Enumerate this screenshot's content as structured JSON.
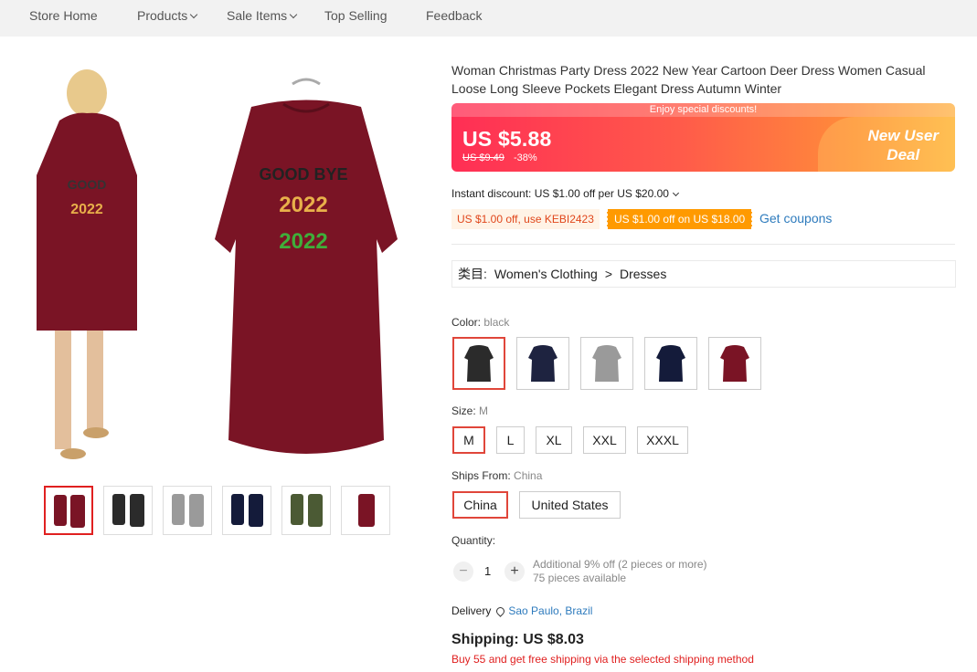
{
  "nav": {
    "store_home": "Store Home",
    "products": "Products",
    "sale_items": "Sale Items",
    "top_selling": "Top Selling",
    "feedback": "Feedback"
  },
  "product": {
    "title": "Woman Christmas Party Dress 2022 New Year Cartoon Deer Dress Women Casual Loose Long Sleeve Pockets Elegant Dress Autumn Winter"
  },
  "price": {
    "banner_note": "Enjoy special discounts!",
    "current": "US $5.88",
    "original": "US $9.49",
    "discount": "-38%",
    "promo_line1": "New User",
    "promo_line2": "Deal"
  },
  "discounts": {
    "instant": "Instant discount: US $1.00 off per US $20.00",
    "coupon1": "US $1.00 off, use KEBI2423",
    "coupon2": "US $1.00 off on US $18.00",
    "get_coupons": "Get coupons"
  },
  "category": {
    "prefix": "类目:",
    "level1": "Women's Clothing",
    "separator": ">",
    "level2": "Dresses"
  },
  "color": {
    "label": "Color:",
    "selected": "black",
    "options": [
      "#2b2b2b",
      "#1e2340",
      "#9a9a9a",
      "#141b3a",
      "#7a1425"
    ],
    "image_theme": "#7a1425"
  },
  "size": {
    "label": "Size:",
    "selected": "M",
    "options": [
      "M",
      "L",
      "XL",
      "XXL",
      "XXXL"
    ]
  },
  "ships_from": {
    "label": "Ships From:",
    "selected": "China",
    "options": [
      "China",
      "United States"
    ]
  },
  "quantity": {
    "label": "Quantity:",
    "minus": "−",
    "value": "1",
    "plus": "+",
    "note1": "Additional 9% off (2 pieces or more)",
    "note2": "75 pieces available"
  },
  "delivery": {
    "label": "Delivery",
    "location": "Sao Paulo, Brazil"
  },
  "shipping": {
    "cost": "Shipping: US $8.03",
    "free_note": "Buy 55 and get free shipping via the selected shipping method"
  },
  "thumbnails": [
    {
      "colors": [
        "#7a1425",
        "#7a1425"
      ]
    },
    {
      "colors": [
        "#2b2b2b",
        "#2b2b2b"
      ]
    },
    {
      "colors": [
        "#9a9a9a",
        "#9a9a9a"
      ]
    },
    {
      "colors": [
        "#141b3a",
        "#141b3a"
      ]
    },
    {
      "colors": [
        "#4b5a34",
        "#4b5a34"
      ]
    },
    {
      "colors": [
        "#7a1425",
        "#7a1425"
      ]
    }
  ]
}
